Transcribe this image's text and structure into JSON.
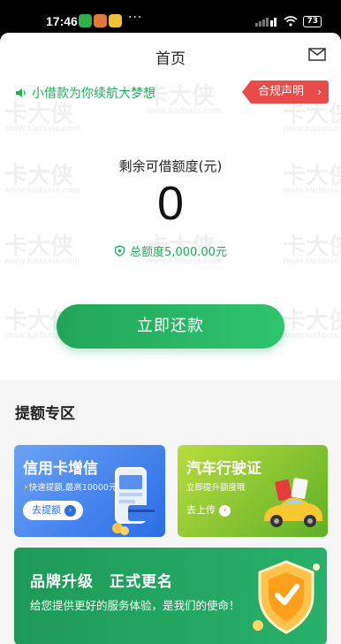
{
  "status_bar": {
    "time": "17:46",
    "battery": "73"
  },
  "header": {
    "title": "首页"
  },
  "promo": {
    "text": "小借款为你续航大梦想",
    "compliance_label": "合规声明"
  },
  "credit": {
    "remaining_label": "剩余可借额度(元)",
    "remaining_value": "0",
    "total_label": "总额度5,000.00元"
  },
  "repay_button": "立即还款",
  "boost_section": {
    "title": "提额专区",
    "cards": [
      {
        "title": "信用卡增信",
        "subtitle": "快速提额,最高10000元",
        "button": "去提额"
      },
      {
        "title": "汽车行驶证",
        "subtitle": "立即提升额度哦",
        "button": "去上传"
      }
    ]
  },
  "banner": {
    "title": "品牌升级　正式更名",
    "subtitle": "给您提供更好的服务体验，是我们的使命！"
  },
  "watermark": {
    "brand": "卡大侠",
    "url": "www.kadaxia.com"
  },
  "colors": {
    "accent_green": "#1faa5c",
    "compliance_red": "#e94b4b",
    "credit_card_blue": "#2a6de6",
    "car_card_green": "#5fb027"
  }
}
